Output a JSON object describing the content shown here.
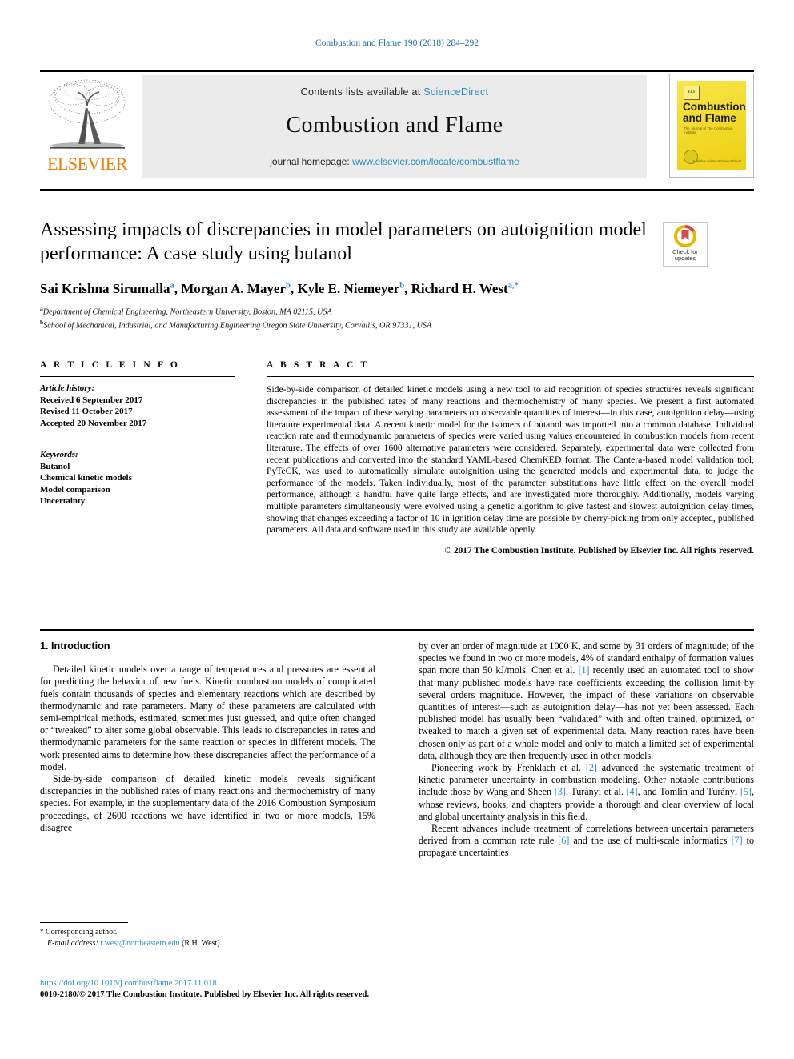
{
  "running_head": "Combustion and Flame 190 (2018) 284–292",
  "masthead": {
    "publisher_wordmark": "ELSEVIER",
    "contents_prefix": "Contents lists available at ",
    "contents_link": "ScienceDirect",
    "journal_title": "Combustion and Flame",
    "homepage_prefix": "journal homepage: ",
    "homepage_url": "www.elsevier.com/locate/combustflame",
    "cover": {
      "title_line1": "Combustion",
      "title_line2": "and Flame",
      "subtitle": "The Journal of The Combustion Institute",
      "publisher_mark": "ELS",
      "footer": "Available online at\nScienceDirect"
    }
  },
  "article": {
    "title": "Assessing impacts of discrepancies in model parameters on autoignition model performance: A case study using butanol",
    "authors": [
      {
        "name": "Sai Krishna Sirumalla",
        "marks": "a"
      },
      {
        "name": "Morgan A. Mayer",
        "marks": "b"
      },
      {
        "name": "Kyle E. Niemeyer",
        "marks": "b"
      },
      {
        "name": "Richard H. West",
        "marks": "a,*"
      }
    ],
    "affiliations": [
      {
        "mark": "a",
        "text": "Department of Chemical Engineering, Northeastern University, Boston, MA 02115, USA"
      },
      {
        "mark": "b",
        "text": "School of Mechanical, Industrial, and Manufacturing Engineering Oregon State University, Corvallis, OR 97331, USA"
      }
    ]
  },
  "crossmark": {
    "line1": "Check for",
    "line2": "updates"
  },
  "article_info": {
    "heading": "A R T I C L E   I N F O",
    "history_label": "Article history:",
    "history": [
      "Received 6 September 2017",
      "Revised 11 October 2017",
      "Accepted 20 November 2017"
    ],
    "keywords_label": "Keywords:",
    "keywords": [
      "Butanol",
      "Chemical kinetic models",
      "Model comparison",
      "Uncertainty"
    ]
  },
  "abstract": {
    "heading": "A B S T R A C T",
    "text": "Side-by-side comparison of detailed kinetic models using a new tool to aid recognition of species structures reveals significant discrepancies in the published rates of many reactions and thermochemistry of many species. We present a first automated assessment of the impact of these varying parameters on observable quantities of interest—in this case, autoignition delay—using literature experimental data. A recent kinetic model for the isomers of butanol was imported into a common database. Individual reaction rate and thermodynamic parameters of species were varied using values encountered in combustion models from recent literature. The effects of over 1600 alternative parameters were considered. Separately, experimental data were collected from recent publications and converted into the standard YAML-based ChemKED format. The Cantera-based model validation tool, PyTeCK, was used to automatically simulate autoignition using the generated models and experimental data, to judge the performance of the models. Taken individually, most of the parameter substitutions have little effect on the overall model performance, although a handful have quite large effects, and are investigated more thoroughly. Additionally, models varying multiple parameters simultaneously were evolved using a genetic algorithm to give fastest and slowest autoignition delay times, showing that changes exceeding a factor of 10 in ignition delay time are possible by cherry-picking from only accepted, published parameters. All data and software used in this study are available openly.",
    "copyright": "© 2017 The Combustion Institute. Published by Elsevier Inc. All rights reserved."
  },
  "body": {
    "section_heading": "1. Introduction",
    "left_paragraphs": [
      "Detailed kinetic models over a range of temperatures and pressures are essential for predicting the behavior of new fuels. Kinetic combustion models of complicated fuels contain thousands of species and elementary reactions which are described by thermodynamic and rate parameters. Many of these parameters are calculated with semi-empirical methods, estimated, sometimes just guessed, and quite often changed or “tweaked” to alter some global observable. This leads to discrepancies in rates and thermodynamic parameters for the same reaction or species in different models. The work presented aims to determine how these discrepancies affect the performance of a model.",
      "Side-by-side comparison of detailed kinetic models reveals significant discrepancies in the published rates of many reactions and thermochemistry of many species. For example, in the supplementary data of the 2016 Combustion Symposium proceedings, of 2600 reactions we have identified in two or more models, 15% disagree"
    ],
    "right_paragraphs": [
      "by over an order of magnitude at 1000 K, and some by 31 orders of magnitude; of the species we found in two or more models, 4% of standard enthalpy of formation values span more than 50 kJ/mols. Chen et al. [1] recently used an automated tool to show that many published models have rate coefficients exceeding the collision limit by several orders magnitude. However, the impact of these variations on observable quantities of interest—such as autoignition delay—has not yet been assessed. Each published model has usually been “validated” with and often trained, optimized, or tweaked to match a given set of experimental data. Many reaction rates have been chosen only as part of a whole model and only to match a limited set of experimental data, although they are then frequently used in other models.",
      "Pioneering work by Frenklach et al. [2] advanced the systematic treatment of kinetic parameter uncertainty in combustion modeling. Other notable contributions include those by Wang and Sheen [3], Turányi et al. [4], and Tomlin and Turányi [5], whose reviews, books, and chapters provide a thorough and clear overview of local and global uncertainty analysis in this field.",
      "Recent advances include treatment of correlations between uncertain parameters derived from a common rate rule [6] and the use of multi-scale informatics [7] to propagate uncertainties"
    ]
  },
  "footnotes": {
    "corresponding_marker": "*",
    "corresponding_text": "Corresponding author.",
    "email_label": "E-mail address:",
    "email": "r.west@northeastern.edu",
    "email_owner": "(R.H. West)."
  },
  "footer": {
    "doi": "https://doi.org/10.1016/j.combustflame.2017.11.018",
    "issn_line": "0010-2180/© 2017 The Combustion Institute. Published by Elsevier Inc. All rights reserved."
  },
  "colors": {
    "link": "#2b8bc0",
    "elsevier_orange": "#ef7d00",
    "cover_yellow": "#f2d725",
    "banner_grey": "#ebebeb"
  }
}
